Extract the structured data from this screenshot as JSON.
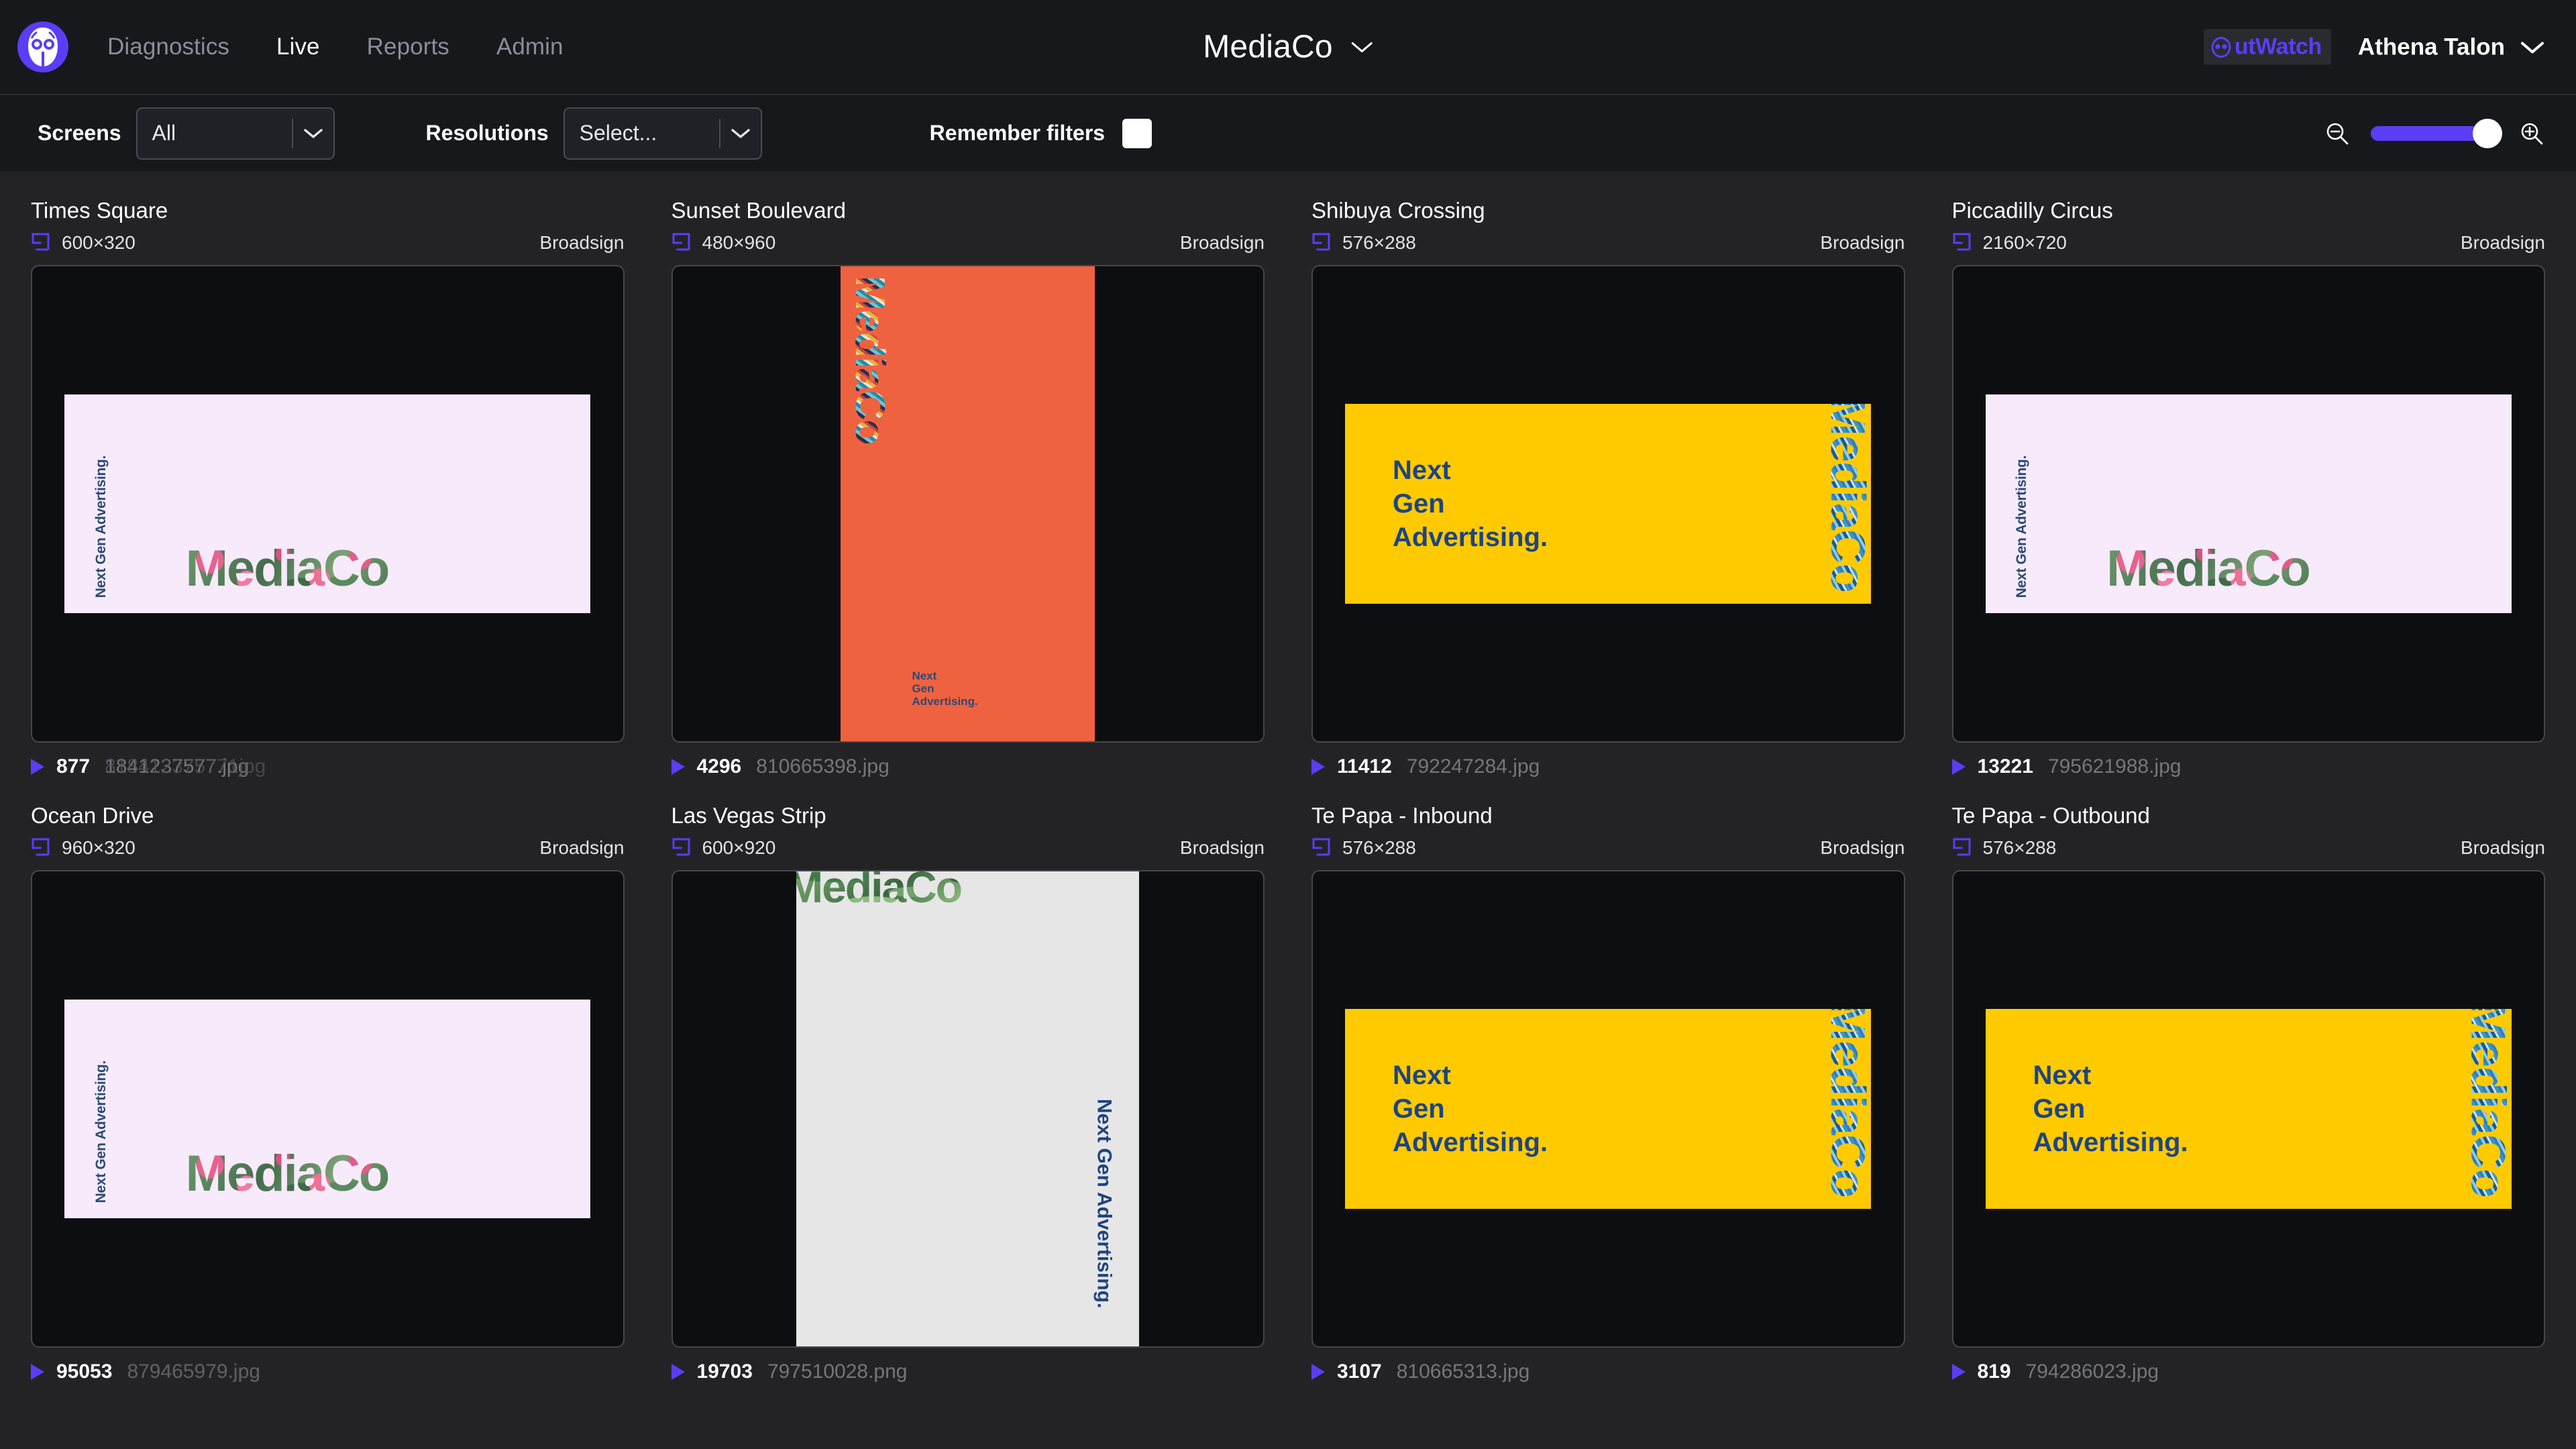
{
  "header": {
    "logo_icon": "owl-logo-icon",
    "nav": [
      {
        "label": "Diagnostics",
        "active": false
      },
      {
        "label": "Live",
        "active": true
      },
      {
        "label": "Reports",
        "active": false
      },
      {
        "label": "Admin",
        "active": false
      }
    ],
    "brand_title": "MediaCo",
    "brand_chevron_icon": "chevron-down-icon",
    "product_badge": "utWatch",
    "product_badge_full": "OutWatch",
    "user_name": "Athena Talon",
    "user_chevron_icon": "chevron-down-icon"
  },
  "filters": {
    "screens_label": "Screens",
    "screens_value": "All",
    "resolutions_label": "Resolutions",
    "resolutions_placeholder": "Select...",
    "remember_label": "Remember filters",
    "remember_checked": false,
    "zoom_out_icon": "zoom-out-icon",
    "zoom_in_icon": "zoom-in-icon",
    "zoom_value": 92,
    "accent_color": "#5b3df5"
  },
  "creative_text": {
    "tagline_line1": "Next",
    "tagline_line2": "Gen",
    "tagline_line3": "Advertising.",
    "tagline_full": "Next Gen Advertising.",
    "wordmark": "MediaCo",
    "wordmark_line1": "Media",
    "wordmark_line2": "Co"
  },
  "cards": [
    {
      "title": "Times Square",
      "resolution": "600×320",
      "vendor": "Broadsign",
      "play_id": "877",
      "filename": "1841237577.jpg",
      "ghost_filename": "818412375771jpg",
      "creative_style": "floral-lavender",
      "bg": "#f7eafb"
    },
    {
      "title": "Sunset Boulevard",
      "resolution": "480×960",
      "vendor": "Broadsign",
      "play_id": "4296",
      "filename": "810665398.jpg",
      "ghost_filename": "",
      "creative_style": "orange-portrait",
      "bg": "#ef6240"
    },
    {
      "title": "Shibuya Crossing",
      "resolution": "576×288",
      "vendor": "Broadsign",
      "play_id": "11412",
      "filename": "792247284.jpg",
      "ghost_filename": "",
      "creative_style": "yellow-landscape",
      "bg": "#ffca00"
    },
    {
      "title": "Piccadilly Circus",
      "resolution": "2160×720",
      "vendor": "Broadsign",
      "play_id": "13221",
      "filename": "795621988.jpg",
      "ghost_filename": "",
      "creative_style": "floral-lavender",
      "bg": "#f7eafb"
    },
    {
      "title": "Ocean Drive",
      "resolution": "960×320",
      "vendor": "Broadsign",
      "play_id": "95053",
      "filename": "879465979.jpg",
      "ghost_filename": "879465979.jpg",
      "creative_style": "floral-lavender",
      "bg": "#f7eafb"
    },
    {
      "title": "Las Vegas Strip",
      "resolution": "600×920",
      "vendor": "Broadsign",
      "play_id": "19703",
      "filename": "797510028.png",
      "ghost_filename": "",
      "creative_style": "grey-portrait",
      "bg": "#e6e6e6"
    },
    {
      "title": "Te Papa - Inbound",
      "resolution": "576×288",
      "vendor": "Broadsign",
      "play_id": "3107",
      "filename": "810665313.jpg",
      "ghost_filename": "",
      "creative_style": "yellow-landscape",
      "bg": "#ffca00"
    },
    {
      "title": "Te Papa - Outbound",
      "resolution": "576×288",
      "vendor": "Broadsign",
      "play_id": "819",
      "filename": "794286023.jpg",
      "ghost_filename": "",
      "creative_style": "yellow-landscape",
      "bg": "#ffca00"
    }
  ]
}
